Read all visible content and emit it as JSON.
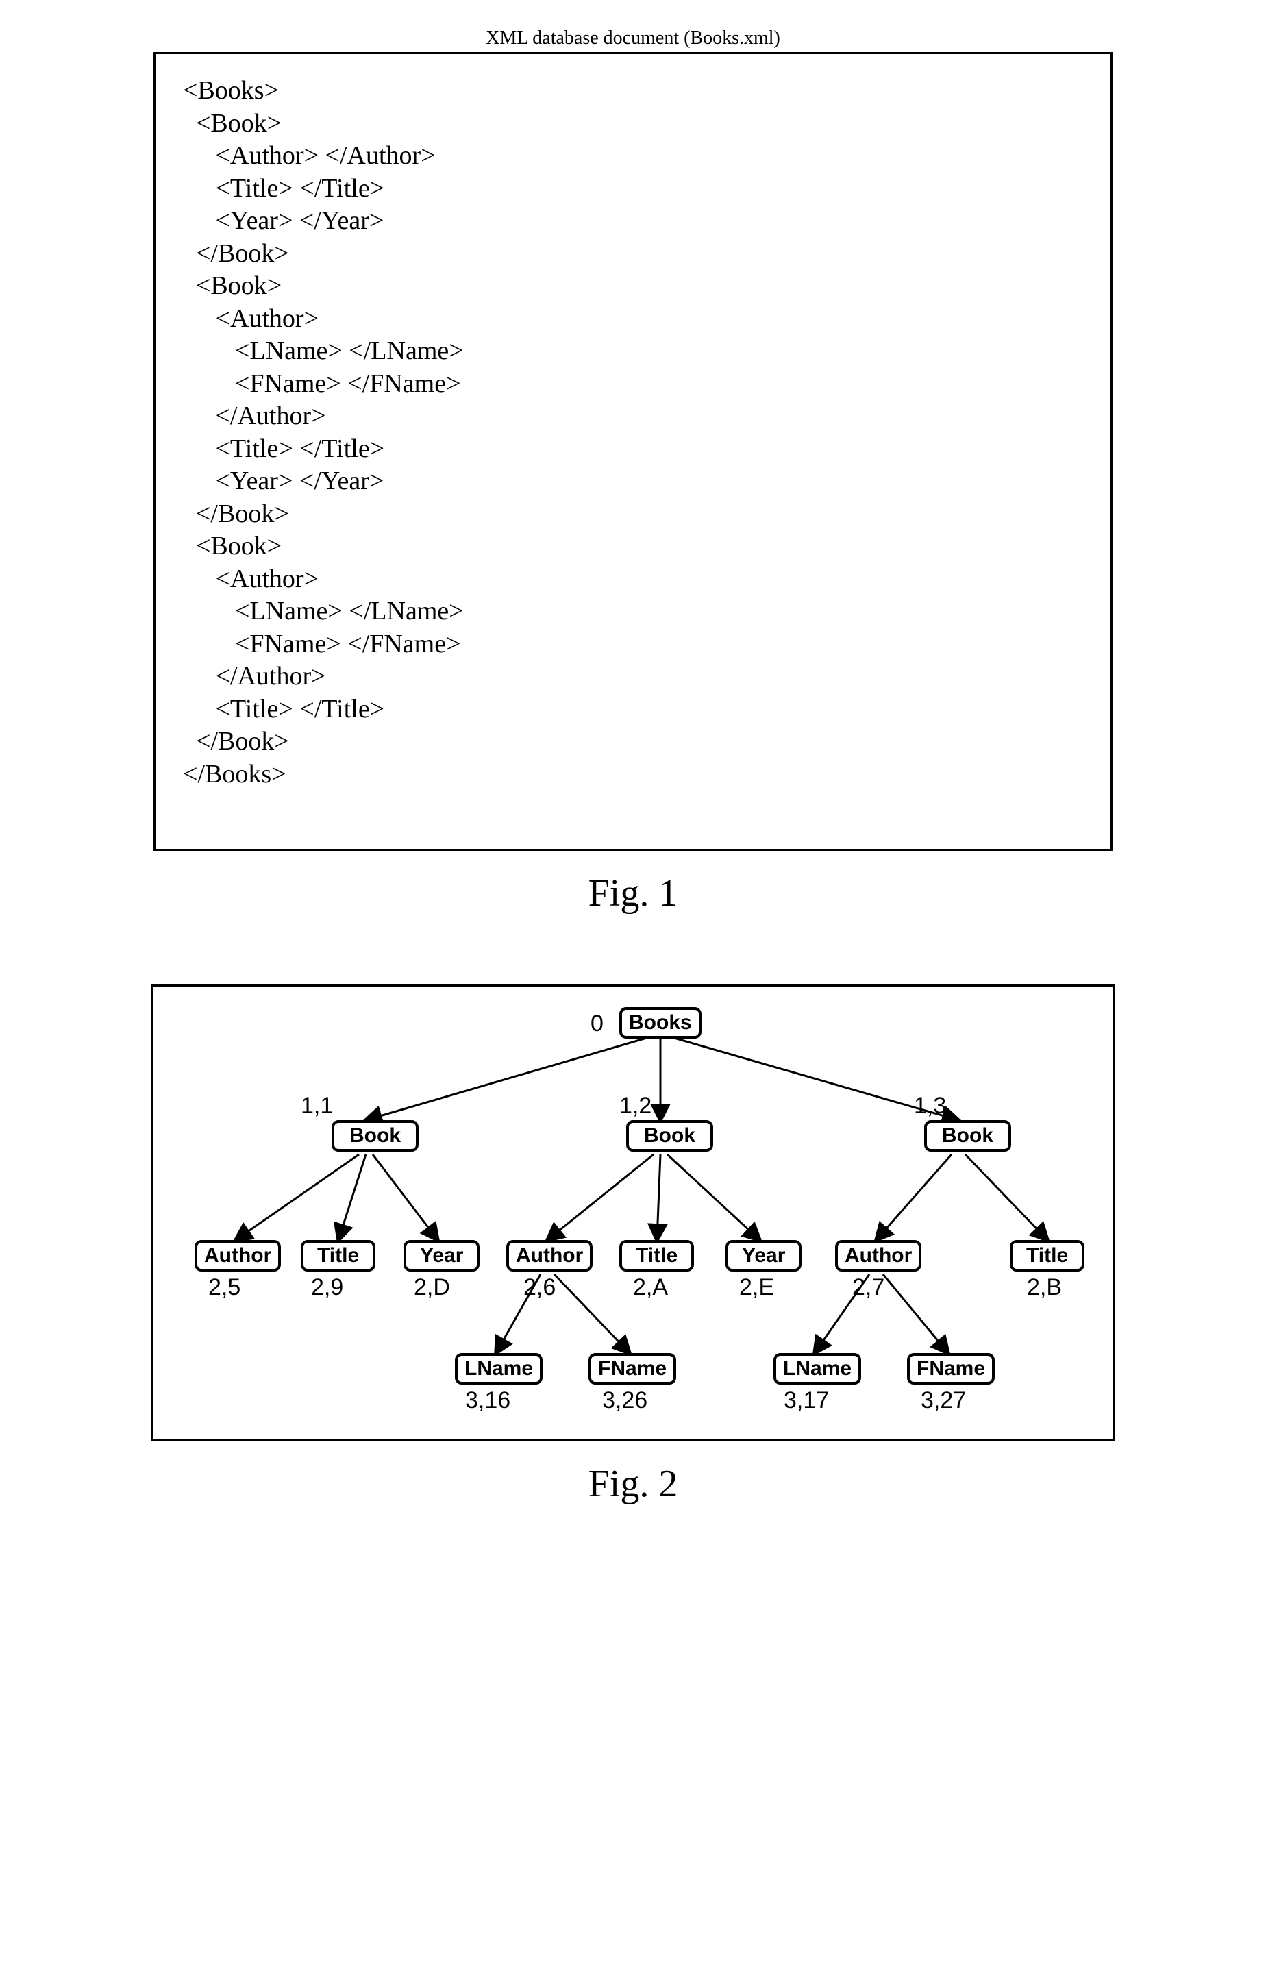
{
  "fig1": {
    "title": "XML database document (Books.xml)",
    "xml": "<Books>\n  <Book>\n     <Author> </Author>\n     <Title> </Title>\n     <Year> </Year>\n  </Book>\n  <Book>\n     <Author>\n        <LName> </LName>\n        <FName> </FName>\n     </Author>\n     <Title> </Title>\n     <Year> </Year>\n  </Book>\n  <Book>\n     <Author>\n        <LName> </LName>\n        <FName> </FName>\n     </Author>\n     <Title> </Title>\n  </Book>\n</Books>",
    "caption": "Fig. 1"
  },
  "fig2": {
    "caption": "Fig. 2",
    "root": {
      "label": "Books",
      "id": "0"
    },
    "level1": [
      {
        "label": "Book",
        "id": "1,1"
      },
      {
        "label": "Book",
        "id": "1,2"
      },
      {
        "label": "Book",
        "id": "1,3"
      }
    ],
    "level2": [
      {
        "label": "Author",
        "id": "2,5",
        "parent": 0
      },
      {
        "label": "Title",
        "id": "2,9",
        "parent": 0
      },
      {
        "label": "Year",
        "id": "2,D",
        "parent": 0
      },
      {
        "label": "Author",
        "id": "2,6",
        "parent": 1
      },
      {
        "label": "Title",
        "id": "2,A",
        "parent": 1
      },
      {
        "label": "Year",
        "id": "2,E",
        "parent": 1
      },
      {
        "label": "Author",
        "id": "2,7",
        "parent": 2
      },
      {
        "label": "Title",
        "id": "2,B",
        "parent": 2
      }
    ],
    "level3": [
      {
        "label": "LName",
        "id": "3,16",
        "parent": 3
      },
      {
        "label": "FName",
        "id": "3,26",
        "parent": 3
      },
      {
        "label": "LName",
        "id": "3,17",
        "parent": 6
      },
      {
        "label": "FName",
        "id": "3,27",
        "parent": 6
      }
    ]
  }
}
